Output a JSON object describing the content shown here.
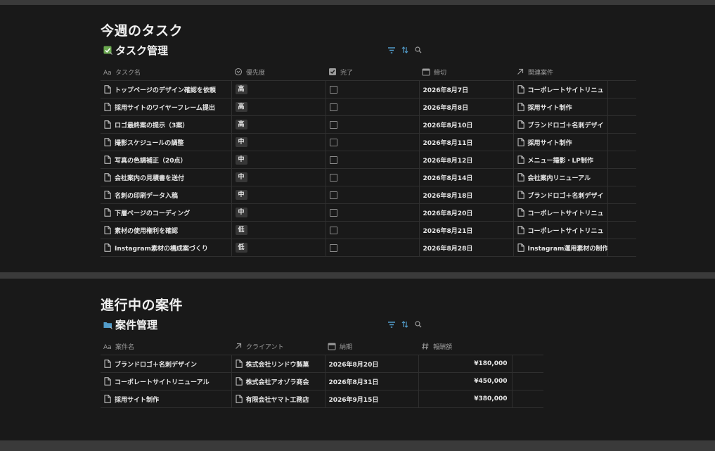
{
  "tasks_section": {
    "heading": "今週のタスク",
    "db_title": "タスク管理",
    "columns": {
      "name": "タスク名",
      "priority": "優先度",
      "done": "完了",
      "due": "締切",
      "related": "関連案件"
    },
    "rows": [
      {
        "name": "トップページのデザイン確認を依頼",
        "priority": "高",
        "done": false,
        "due": "2026年8月7日",
        "related": "コーポレートサイトリニュ"
      },
      {
        "name": "採用サイトのワイヤーフレーム提出",
        "priority": "高",
        "done": false,
        "due": "2026年8月8日",
        "related": "採用サイト制作"
      },
      {
        "name": "ロゴ最終案の提示（3案）",
        "priority": "高",
        "done": false,
        "due": "2026年8月10日",
        "related": "ブランドロゴ＋名刺デザイ"
      },
      {
        "name": "撮影スケジュールの調整",
        "priority": "中",
        "done": false,
        "due": "2026年8月11日",
        "related": "採用サイト制作"
      },
      {
        "name": "写真の色調補正（20点）",
        "priority": "中",
        "done": false,
        "due": "2026年8月12日",
        "related": "メニュー撮影・LP制作"
      },
      {
        "name": "会社案内の見積書を送付",
        "priority": "中",
        "done": false,
        "due": "2026年8月14日",
        "related": "会社案内リニューアル"
      },
      {
        "name": "名刺の印刷データ入稿",
        "priority": "中",
        "done": false,
        "due": "2026年8月18日",
        "related": "ブランドロゴ＋名刺デザイ"
      },
      {
        "name": "下層ページのコーディング",
        "priority": "中",
        "done": false,
        "due": "2026年8月20日",
        "related": "コーポレートサイトリニュ"
      },
      {
        "name": "素材の使用権利を確認",
        "priority": "低",
        "done": false,
        "due": "2026年8月21日",
        "related": "コーポレートサイトリニュ"
      },
      {
        "name": "Instagram素材の構成案づくり",
        "priority": "低",
        "done": false,
        "due": "2026年8月28日",
        "related": "Instagram運用素材の制作"
      }
    ]
  },
  "projects_section": {
    "heading": "進行中の案件",
    "db_title": "案件管理",
    "columns": {
      "name": "案件名",
      "client": "クライアント",
      "delivery": "納期",
      "fee": "報酬額"
    },
    "rows": [
      {
        "name": "ブランドロゴ＋名刺デザイン",
        "client": "株式会社リンドウ製菓",
        "delivery": "2026年8月20日",
        "fee": "¥180,000"
      },
      {
        "name": "コーポレートサイトリニューアル",
        "client": "株式会社アオゾラ商会",
        "delivery": "2026年8月31日",
        "fee": "¥450,000"
      },
      {
        "name": "採用サイト制作",
        "client": "有限会社ヤマト工務店",
        "delivery": "2026年9月15日",
        "fee": "¥380,000"
      }
    ]
  },
  "colors": {
    "background": "#191919",
    "accent": "#529cca",
    "tag_bg": "#373737"
  },
  "icons": {
    "tasks_db": "checkbox-icon",
    "projects_db": "folder-icon",
    "filter": "filter-icon",
    "sort": "sort-icon",
    "search": "search-icon",
    "row": "page-icon"
  }
}
